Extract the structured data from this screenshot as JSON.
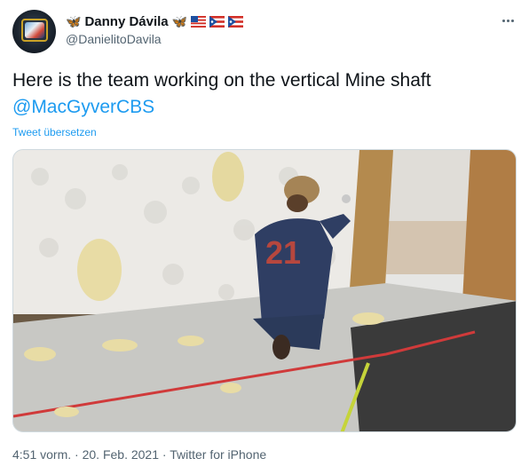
{
  "user": {
    "display_name": "Danny Dávila",
    "handle": "@DanielitoDavila",
    "name_emojis": [
      "butterfly-emoji",
      "butterfly-emoji",
      "us-flag-emoji",
      "puerto-rico-flag-emoji",
      "puerto-rico-flag-emoji"
    ]
  },
  "tweet": {
    "text": "Here is the team working on the vertical Mine shaft",
    "mention": "@MacGyverCBS",
    "translate_label": "Tweet übersetzen",
    "time": "4:51 vorm.",
    "date": "20. Feb. 2021",
    "source": "Twitter for iPhone",
    "separator": "·"
  },
  "media": {
    "jersey_number": "21",
    "description_icon": "video-still"
  },
  "icons": {
    "more": "more-dots-icon"
  },
  "colors": {
    "link": "#1d9bf0",
    "secondary_text": "#536471",
    "primary_text": "#0f1419"
  }
}
